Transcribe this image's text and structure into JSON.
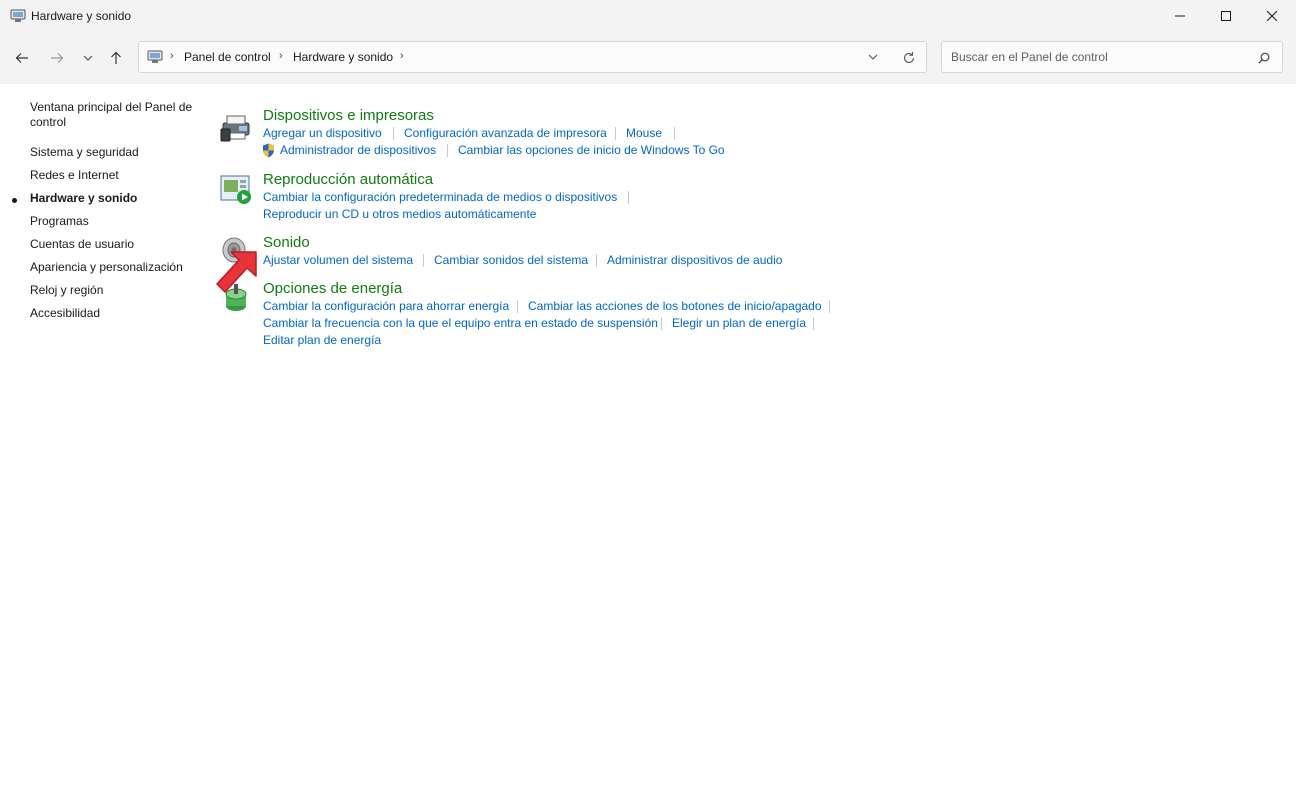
{
  "window": {
    "title": "Hardware y sonido"
  },
  "address": {
    "crumbs": [
      "Panel de control",
      "Hardware y sonido"
    ]
  },
  "search": {
    "placeholder": "Buscar en el Panel de control"
  },
  "sidebar": {
    "items": [
      {
        "label": "Ventana principal del Panel de control"
      },
      {
        "label": "Sistema y seguridad"
      },
      {
        "label": "Redes e Internet"
      },
      {
        "label": "Hardware y sonido",
        "active": true
      },
      {
        "label": "Programas"
      },
      {
        "label": "Cuentas de usuario"
      },
      {
        "label": "Apariencia y personalización"
      },
      {
        "label": "Reloj y región"
      },
      {
        "label": "Accesibilidad"
      }
    ]
  },
  "categories": [
    {
      "title": "Dispositivos e impresoras",
      "links": [
        "Agregar un dispositivo",
        "Configuración avanzada de impresora",
        "Mouse",
        "Administrador de dispositivos",
        "Cambiar las opciones de inicio de Windows To Go"
      ]
    },
    {
      "title": "Reproducción automática",
      "links": [
        "Cambiar la configuración predeterminada de medios o dispositivos",
        "Reproducir un CD u otros medios automáticamente"
      ]
    },
    {
      "title": "Sonido",
      "links": [
        "Ajustar volumen del sistema",
        "Cambiar sonidos del sistema",
        "Administrar dispositivos de audio"
      ]
    },
    {
      "title": "Opciones de energía",
      "links": [
        "Cambiar la configuración para ahorrar energía",
        "Cambiar las acciones de los botones de inicio/apagado",
        "Cambiar la frecuencia con la que el equipo entra en estado de suspensión",
        "Elegir un plan de energía",
        "Editar plan de energía"
      ]
    }
  ],
  "colors": {
    "category_title": "#107c10",
    "link": "#0066cc",
    "annotation_arrow": "#e8333a"
  },
  "icons": [
    "control-panel-icon",
    "back-arrow-icon",
    "forward-arrow-icon",
    "recent-chevron-icon",
    "up-arrow-icon",
    "refresh-icon",
    "search-icon",
    "shield-icon",
    "printer-icon",
    "autoplay-icon",
    "speaker-icon",
    "power-icon"
  ]
}
